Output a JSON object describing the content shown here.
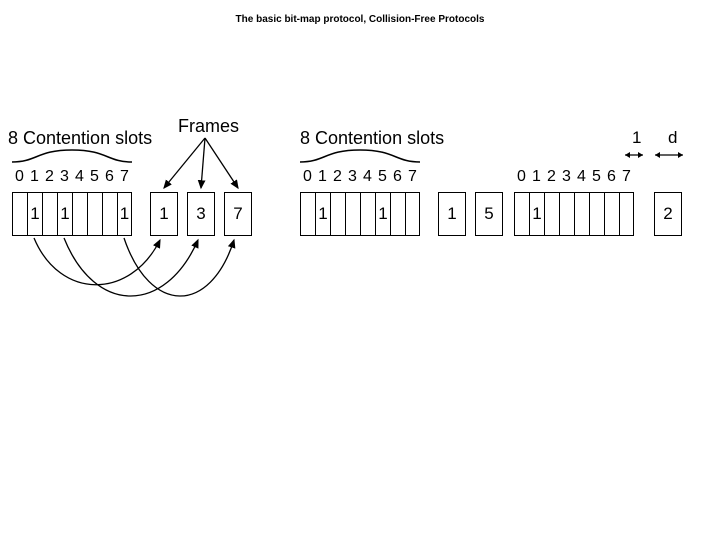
{
  "title": "The basic bit-map protocol, Collision-Free Protocols",
  "labels": {
    "contention1": "8 Contention slots",
    "contention2": "8 Contention slots",
    "frames": "Frames",
    "dim1": "1",
    "dimd": "d"
  },
  "slot_numbers": [
    "0",
    "1",
    "2",
    "3",
    "4",
    "5",
    "6",
    "7"
  ],
  "group1_values": [
    "",
    "1",
    "",
    "1",
    "",
    "",
    "",
    "1"
  ],
  "frames1": [
    "1",
    "3",
    "7"
  ],
  "group2_values": [
    "",
    "1",
    "",
    "",
    "",
    "1",
    "",
    ""
  ],
  "frames2": [
    "1",
    "5"
  ],
  "group3_values": [
    "",
    "1",
    "",
    "",
    "",
    "",
    "",
    ""
  ],
  "frames3": [
    "2"
  ]
}
